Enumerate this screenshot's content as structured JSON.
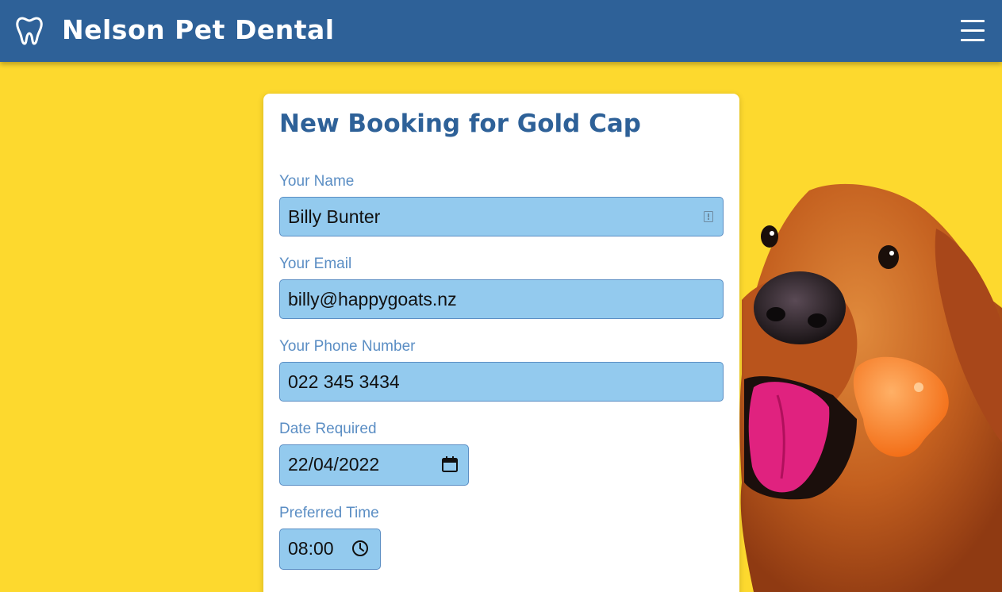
{
  "header": {
    "brand": "Nelson Pet Dental",
    "logo_icon": "tooth-icon",
    "menu_icon": "hamburger-menu-icon",
    "background": "#2e6198"
  },
  "page": {
    "background": "#fdd92e",
    "hero_image": "golden-retriever-with-orange-chew-toy"
  },
  "form": {
    "title": "New Booking for Gold Cap",
    "title_color": "#2e6198",
    "label_color": "#5b8ec4",
    "field_color": "#93caee",
    "fields": {
      "name": {
        "label": "Your Name",
        "value": "Billy Bunter",
        "icon": "contact-card-icon"
      },
      "email": {
        "label": "Your Email",
        "value": "billy@happygoats.nz"
      },
      "phone": {
        "label": "Your Phone Number",
        "value": "022 345 3434"
      },
      "date": {
        "label": "Date Required",
        "value": "22/04/2022",
        "icon": "calendar-icon"
      },
      "time": {
        "label": "Preferred Time",
        "value": "08:00",
        "icon": "clock-icon"
      }
    }
  }
}
